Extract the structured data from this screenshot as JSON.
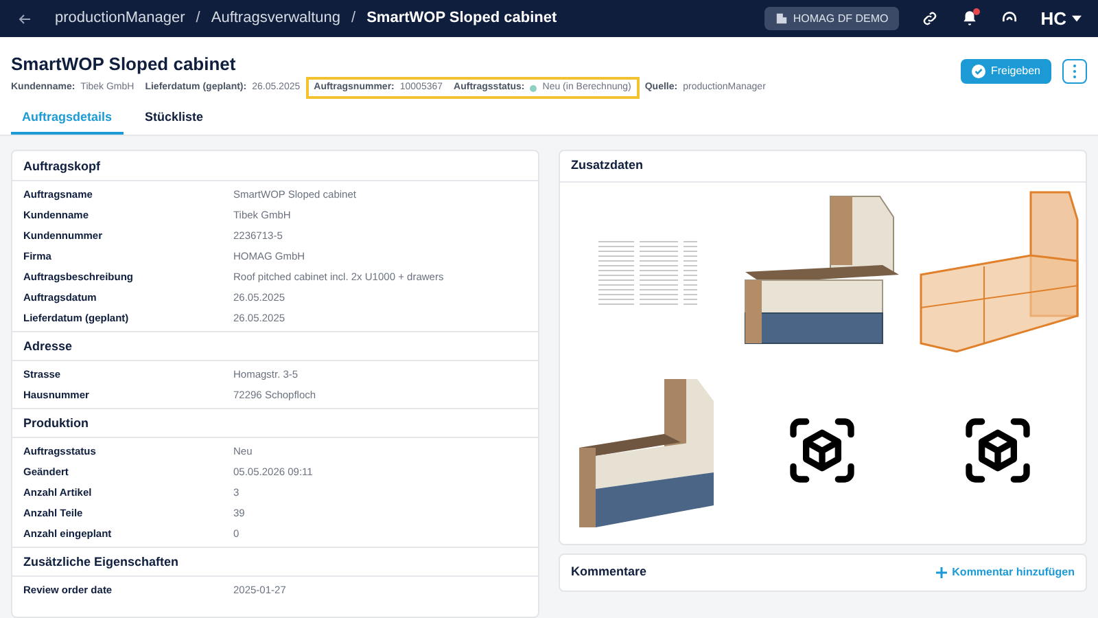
{
  "topbar": {
    "breadcrumbs": [
      {
        "label": "productionManager",
        "current": false
      },
      {
        "label": "Auftragsverwaltung",
        "current": false
      },
      {
        "label": "SmartWOP Sloped cabinet",
        "current": true
      }
    ],
    "separator": "/",
    "tenant": "HOMAG DF DEMO",
    "notification": true,
    "user_initials": "HC"
  },
  "header": {
    "title": "SmartWOP Sloped cabinet",
    "meta": [
      {
        "label": "Kundenname:",
        "value": "Tibek GmbH",
        "highlighted": false
      },
      {
        "label": "Lieferdatum (geplant):",
        "value": "26.05.2025",
        "highlighted": false
      },
      {
        "label": "Auftragsnummer:",
        "value": "10005367",
        "highlighted": true
      },
      {
        "label": "Auftragsstatus:",
        "value": "Neu (in Berechnung)",
        "highlighted": true,
        "dot": true
      },
      {
        "label": "Quelle:",
        "value": "productionManager",
        "highlighted": false
      }
    ],
    "primary_button": "Freigeben"
  },
  "tabs": [
    {
      "label": "Auftragsdetails",
      "selected": true
    },
    {
      "label": "Stückliste",
      "selected": false
    }
  ],
  "details": {
    "sections": [
      {
        "title": "Auftragskopf",
        "rows": [
          [
            "Auftragsname",
            "SmartWOP Sloped cabinet"
          ],
          [
            "Kundenname",
            "Tibek GmbH"
          ],
          [
            "Kundennummer",
            "2236713-5"
          ],
          [
            "Firma",
            "HOMAG GmbH"
          ],
          [
            "Auftragsbeschreibung",
            "Roof pitched cabinet incl. 2x U1000 + drawers"
          ],
          [
            "Auftragsdatum",
            "26.05.2025"
          ],
          [
            "Lieferdatum (geplant)",
            "26.05.2025"
          ]
        ]
      },
      {
        "title": "Adresse",
        "rows": [
          [
            "Strasse",
            "Homagstr. 3-5"
          ],
          [
            "Hausnummer",
            "72296 Schopfloch"
          ]
        ]
      },
      {
        "title": "Produktion",
        "rows": [
          [
            "Auftragsstatus",
            "Neu"
          ],
          [
            "Geändert",
            "05.05.2026 09:11"
          ],
          [
            "Anzahl Artikel",
            "3"
          ],
          [
            "Anzahl Teile",
            "39"
          ],
          [
            "Anzahl eingeplant",
            "0"
          ]
        ]
      },
      {
        "title": "Zusätzliche Eigenschaften",
        "rows": [
          [
            "Review order date",
            "2025-01-27"
          ]
        ]
      }
    ]
  },
  "extra": {
    "title": "Zusatzdaten",
    "thumbnails": [
      {
        "kind": "document"
      },
      {
        "kind": "drawers"
      },
      {
        "kind": "frame"
      },
      {
        "kind": "bench"
      },
      {
        "kind": "ar"
      },
      {
        "kind": "ar"
      }
    ]
  },
  "comments": {
    "title": "Kommentare",
    "action": "Kommentar hinzufügen"
  }
}
